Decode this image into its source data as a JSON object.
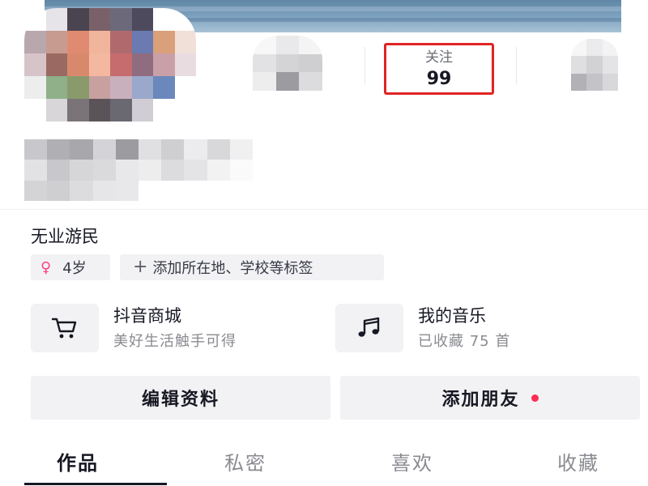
{
  "profile": {
    "follow_label": "关注",
    "follow_count": "99",
    "bio": "无业游民"
  },
  "tags": {
    "gender_symbol": "♀",
    "age": "4岁",
    "add_tag_plus": "+",
    "add_tag_label": "添加所在地、学校等标签"
  },
  "entries": {
    "shop_title": "抖音商城",
    "shop_subtitle": "美好生活触手可得",
    "music_title": "我的音乐",
    "music_subtitle": "已收藏 75 首"
  },
  "buttons": {
    "edit_profile": "编辑资料",
    "add_friends": "添加朋友"
  },
  "tabs": [
    "作品",
    "私密",
    "喜欢",
    "收藏"
  ],
  "colors": {
    "highlight_border": "#e02424",
    "notification_dot": "#fe2c55",
    "female_symbol": "#ff3f7f"
  },
  "icons": {
    "shop": "shopping-cart-icon",
    "music": "music-note-icon"
  }
}
